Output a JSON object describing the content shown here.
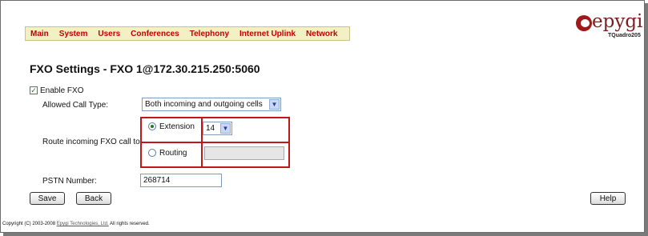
{
  "nav": {
    "items": [
      "Main",
      "System",
      "Users",
      "Conferences",
      "Telephony",
      "Internet Uplink",
      "Network"
    ]
  },
  "brand": {
    "name": "epygi",
    "model": "TQuadro205"
  },
  "page": {
    "title": "FXO Settings - FXO 1@172.30.215.250:5060"
  },
  "form": {
    "enable_fxo": {
      "label": "Enable FXO",
      "checked": true
    },
    "allowed_call_type": {
      "label": "Allowed Call Type:",
      "value": "Both incoming and outgoing cells"
    },
    "route": {
      "label": "Route incoming FXO call to:",
      "extension_label": "Extension",
      "extension_selected": true,
      "extension_value": "14",
      "routing_label": "Routing",
      "routing_selected": false,
      "routing_value": ""
    },
    "pstn_number": {
      "label": "PSTN Number:",
      "value": "268714"
    }
  },
  "buttons": {
    "save": "Save",
    "back": "Back",
    "help": "Help"
  },
  "footer": {
    "prefix": "Copyright (C) 2003-2008",
    "link": "Epygi Technologies, Ltd.",
    "suffix": "All rights reserved."
  },
  "colors": {
    "accent_red": "#c0181a",
    "nav_bg": "#f4f0c6",
    "nav_text": "#c00000"
  }
}
